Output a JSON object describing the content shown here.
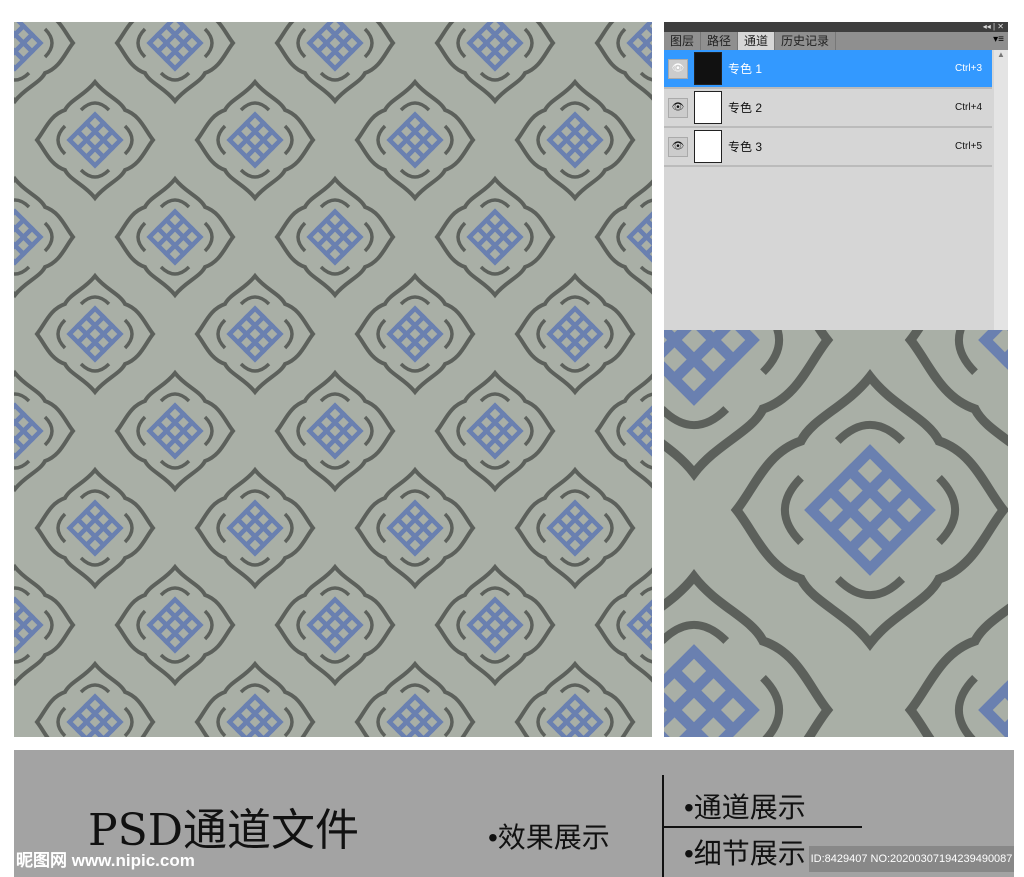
{
  "panel": {
    "controls": "◂◂ | ✕",
    "tabs": [
      "图层",
      "路径",
      "通道",
      "历史记录"
    ],
    "active_tab": "通道",
    "menu_icon": "▾≡",
    "channels": [
      {
        "name": "专色 1",
        "shortcut": "Ctrl+3",
        "selected": true
      },
      {
        "name": "专色 2",
        "shortcut": "Ctrl+4",
        "selected": false
      },
      {
        "name": "专色 3",
        "shortcut": "Ctrl+5",
        "selected": false
      }
    ]
  },
  "footer": {
    "title": "PSD通道文件",
    "effect": "•效果展示",
    "channel": "•通道展示",
    "detail": "•细节展示",
    "watermark": "昵图网 www.nipic.com",
    "id": "ID:8429407 NO:20200307194239490087"
  },
  "colors": {
    "bg": "#a9afa6",
    "outline": "#5c605b",
    "knot": "#6a80b0"
  }
}
